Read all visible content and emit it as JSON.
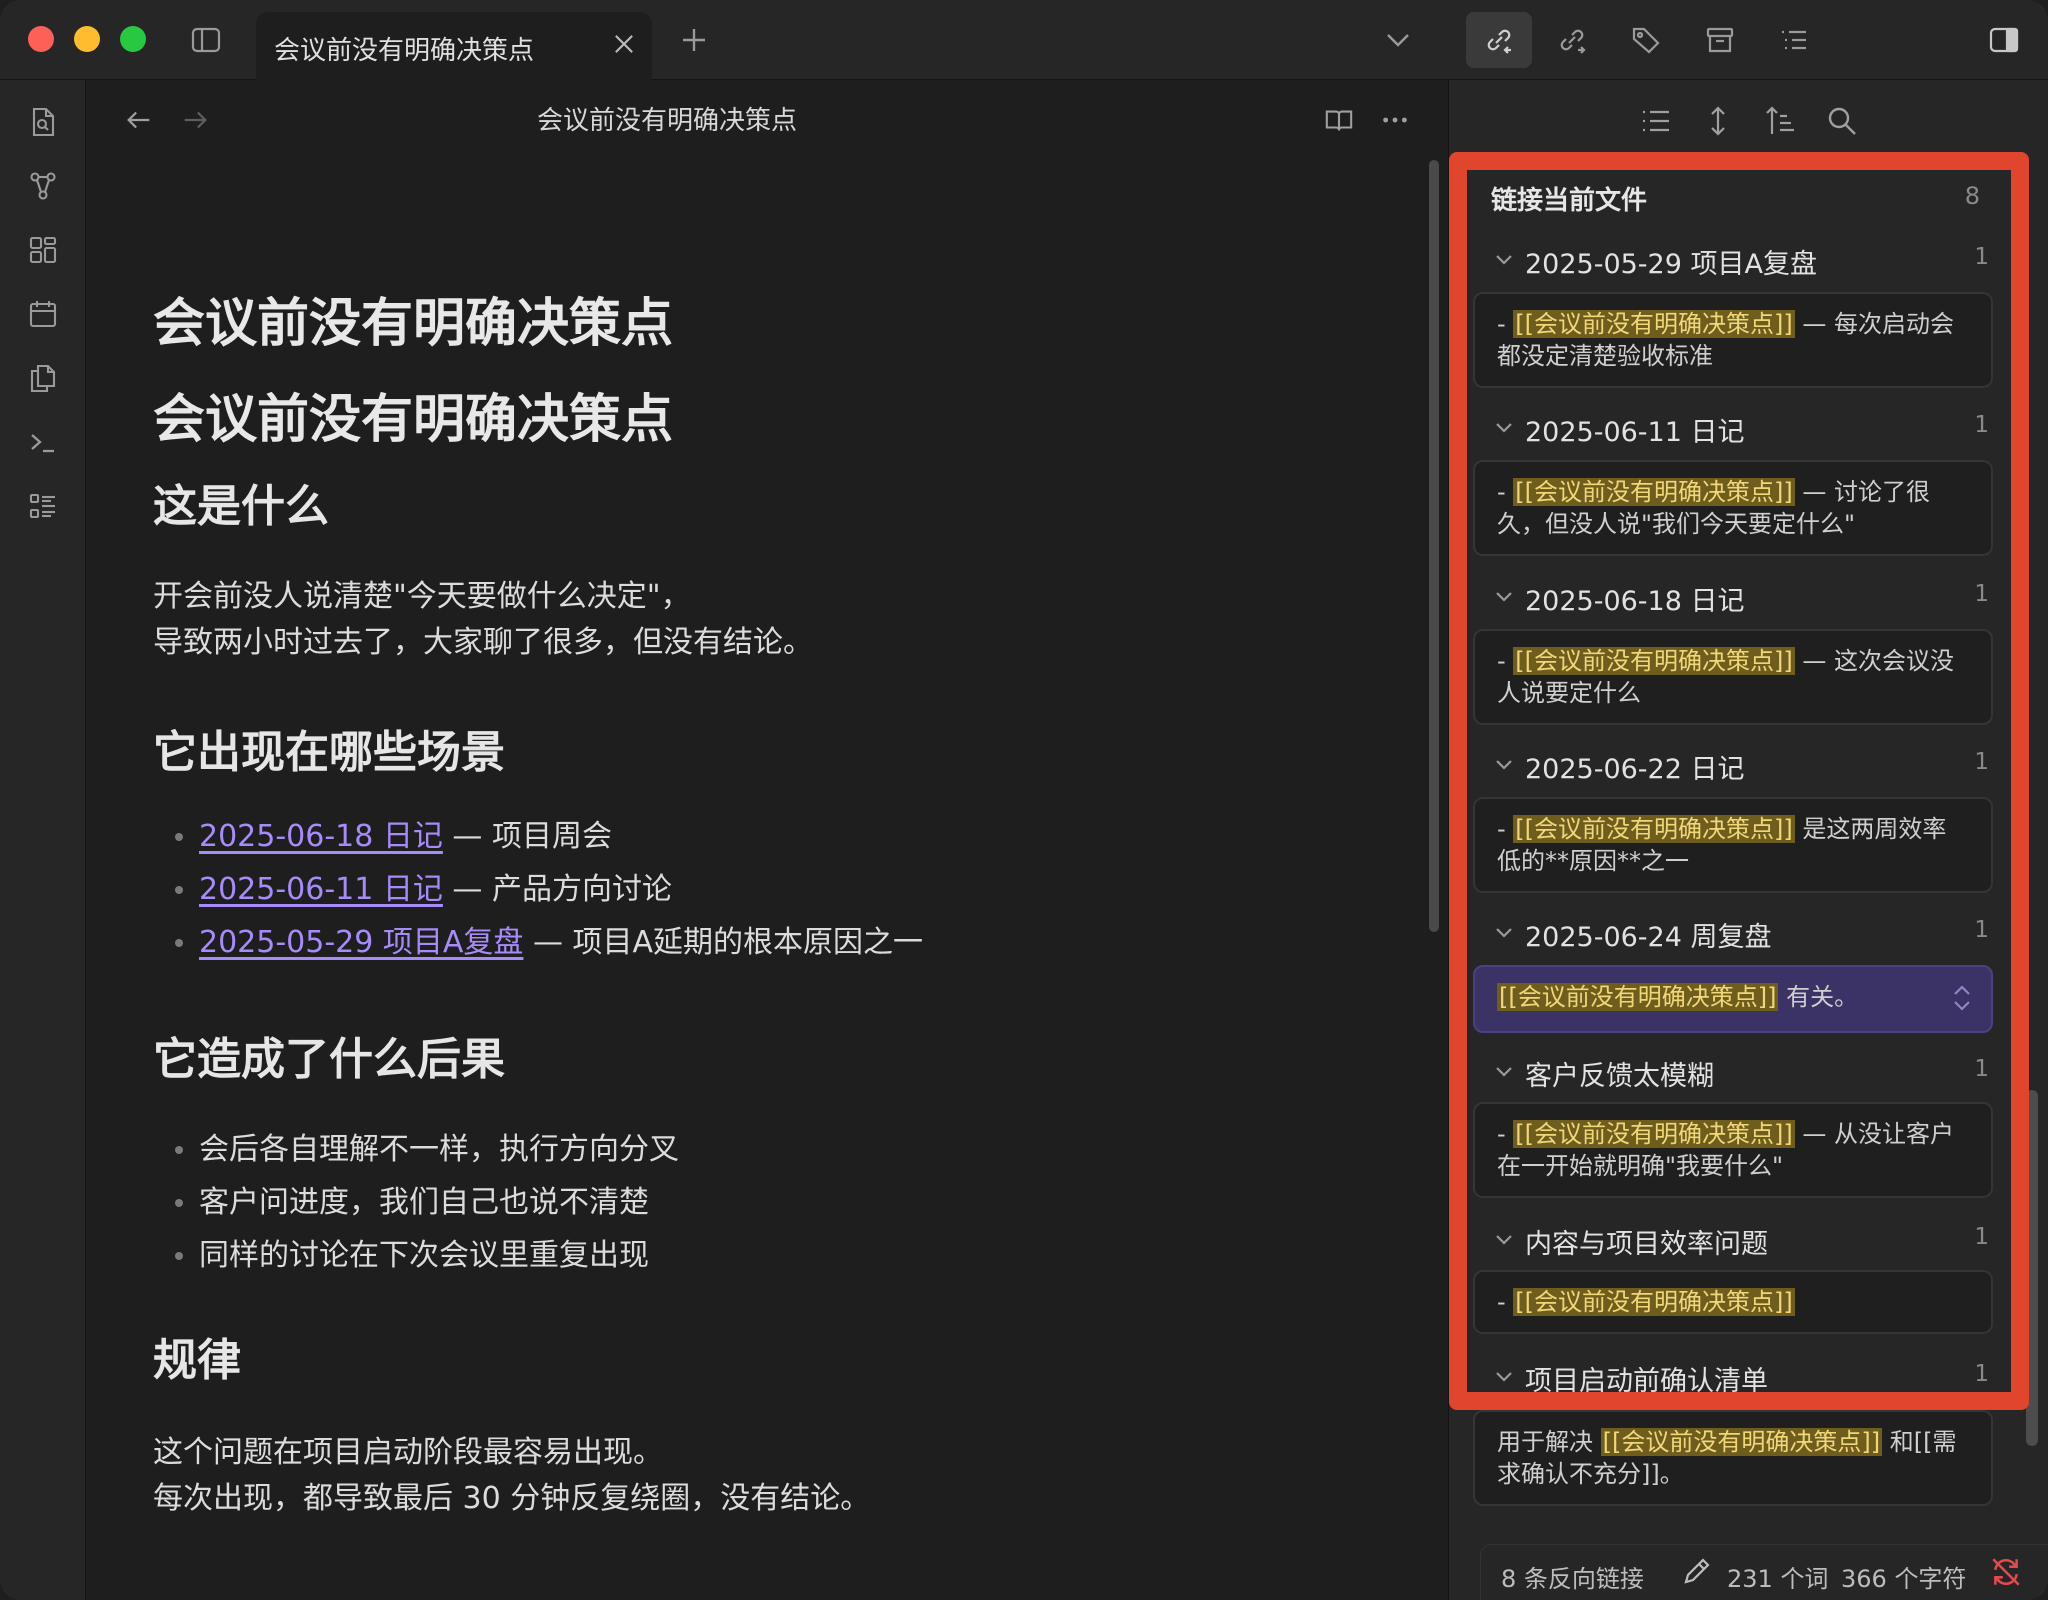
{
  "tab": {
    "title": "会议前没有明确决策点"
  },
  "editor": {
    "header_title": "会议前没有明确决策点",
    "h1_a": "会议前没有明确决策点",
    "h1_b": "会议前没有明确决策点",
    "sec1_title": "这是什么",
    "sec1_line1": "开会前没人说清楚\"今天要做什么决定\"，",
    "sec1_line2": "导致两小时过去了，大家聊了很多，但没有结论。",
    "sec2_title": "它出现在哪些场景",
    "scenes": [
      {
        "link": "2025-06-18 日记",
        "text": " — 项目周会"
      },
      {
        "link": "2025-06-11 日记",
        "text": " — 产品方向讨论"
      },
      {
        "link": "2025-05-29 项目A复盘",
        "text": " — 项目A延期的根本原因之一"
      }
    ],
    "sec3_title": "它造成了什么后果",
    "consequences": [
      "会后各自理解不一样，执行方向分叉",
      "客户问进度，我们自己也说不清楚",
      "同样的讨论在下次会议里重复出现"
    ],
    "sec4_title": "规律",
    "sec4_line1": "这个问题在项目启动阶段最容易出现。",
    "sec4_line2": "每次出现，都导致最后 30 分钟反复绕圈，没有结论。"
  },
  "backlinks": {
    "header": "链接当前文件",
    "count": "8",
    "groups": [
      {
        "title": "2025-05-29 项目A复盘",
        "count": "1",
        "pre": "- ",
        "link": "[[会议前没有明确决策点]]",
        "post": " — 每次启动会都没定清楚验收标准"
      },
      {
        "title": "2025-06-11 日记",
        "count": "1",
        "pre": "- ",
        "link": "[[会议前没有明确决策点]]",
        "post": " — 讨论了很久，但没人说\"我们今天要定什么\""
      },
      {
        "title": "2025-06-18 日记",
        "count": "1",
        "pre": "- ",
        "link": "[[会议前没有明确决策点]]",
        "post": " — 这次会议没人说要定什么"
      },
      {
        "title": "2025-06-22 日记",
        "count": "1",
        "pre": "- ",
        "link": "[[会议前没有明确决策点]]",
        "post": " 是这两周效率低的**原因**之一"
      },
      {
        "title": "2025-06-24 周复盘",
        "count": "1",
        "pre": "",
        "link": "[[会议前没有明确决策点]]",
        "post": " 有关。"
      },
      {
        "title": "客户反馈太模糊",
        "count": "1",
        "pre": "- ",
        "link": "[[会议前没有明确决策点]]",
        "post": " — 从没让客户在一开始就明确\"我要什么\""
      },
      {
        "title": "内容与项目效率问题",
        "count": "1",
        "pre": "- ",
        "link": "[[会议前没有明确决策点]]",
        "post": ""
      },
      {
        "title": "项目启动前确认清单",
        "count": "1",
        "pre": "用于解决 ",
        "link": "[[会议前没有明确决策点]]",
        "post": " 和[[需求确认不充分]]。"
      }
    ]
  },
  "status": {
    "backlinks": "8 条反向链接",
    "words": "231 个词",
    "chars": "366 个字符"
  },
  "colors": {
    "accent": "#a88bfa",
    "highlight": "#6f5d1e",
    "frame": "#e2452e"
  }
}
